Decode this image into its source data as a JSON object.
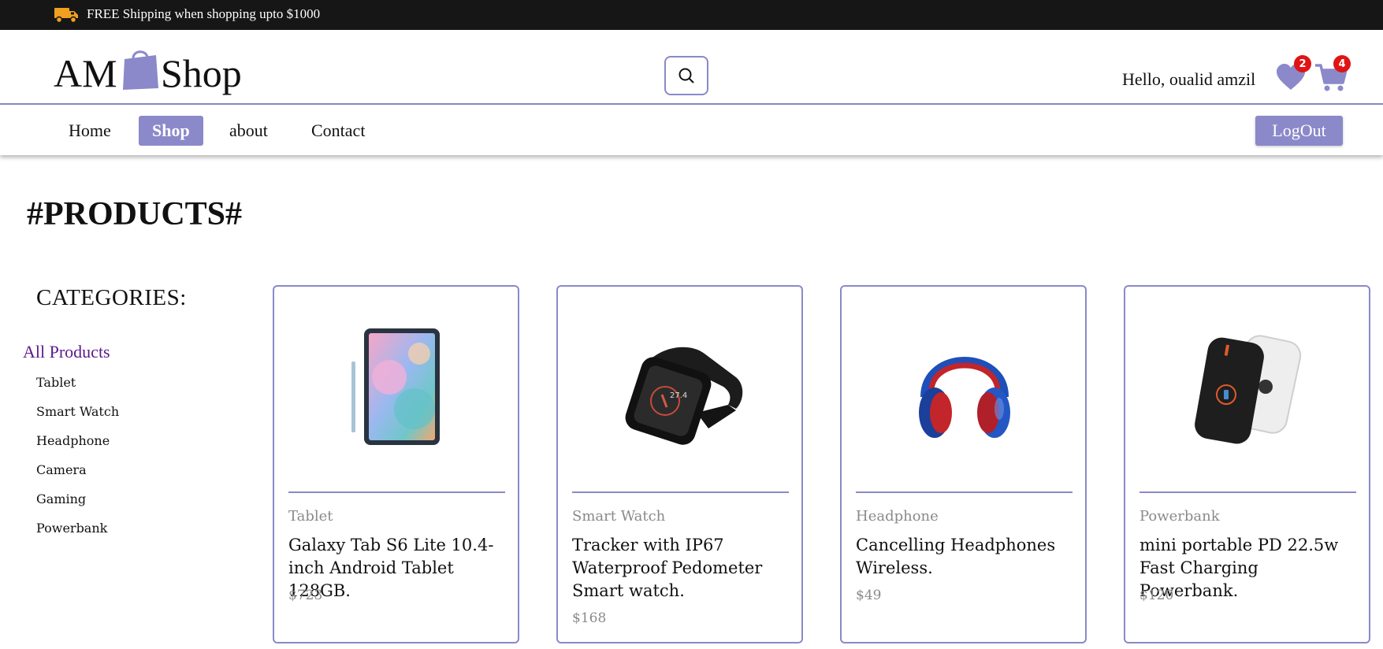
{
  "promo": {
    "text": "FREE Shipping when shopping upto $1000"
  },
  "logo": {
    "left_text": "AM",
    "right_text": "Shop"
  },
  "user": {
    "greeting": "Hello, oualid amzil"
  },
  "wishlist": {
    "count": "2"
  },
  "cart": {
    "count": "4"
  },
  "nav": {
    "items": [
      {
        "label": "Home",
        "active": false
      },
      {
        "label": "Shop",
        "active": true
      },
      {
        "label": "about",
        "active": false
      },
      {
        "label": "Contact",
        "active": false
      }
    ],
    "logout_label": "LogOut"
  },
  "page": {
    "title": "#PRODUCTS#"
  },
  "categories": {
    "heading": "CATEGORIES:",
    "all_label": "All Products",
    "items": [
      "Tablet",
      "Smart Watch",
      "Headphone",
      "Camera",
      "Gaming",
      "Powerbank"
    ]
  },
  "products": [
    {
      "category": "Tablet",
      "title": "Galaxy Tab S6 Lite 10.4-inch Android Tablet 128GB.",
      "price": "$723",
      "image": "tablet-image"
    },
    {
      "category": "Smart Watch",
      "title": "Tracker with IP67 Waterproof Pedometer Smart watch.",
      "price": "$168",
      "image": "smartwatch-image"
    },
    {
      "category": "Headphone",
      "title": "Cancelling Headphones Wireless.",
      "price": "$49",
      "image": "headphones-image"
    },
    {
      "category": "Powerbank",
      "title": "mini portable PD 22.5w Fast Charging Powerbank.",
      "price": "$120",
      "image": "powerbank-image"
    }
  ],
  "colors": {
    "accent": "#8b89c9",
    "badge": "#e01414",
    "topbar": "#161616",
    "truck": "#f0a020",
    "all_products": "#5b1a8c"
  }
}
